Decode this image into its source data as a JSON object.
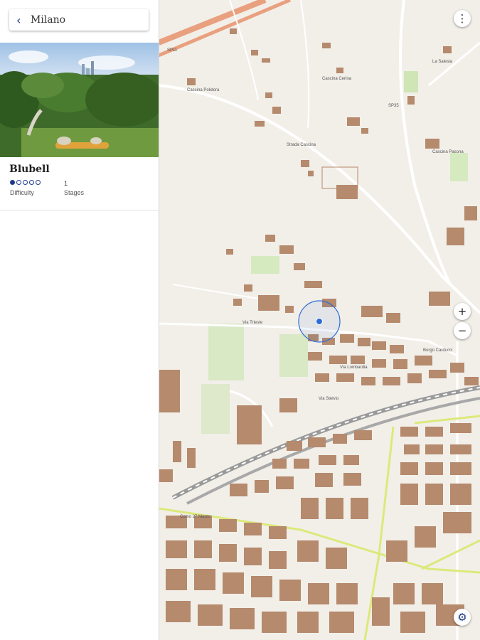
{
  "panel": {
    "back_label": "Milano",
    "back_icon": "chevron-left-icon",
    "trail_name": "Blubell",
    "difficulty_level": 1,
    "difficulty_max": 5,
    "difficulty_label": "Difficulty",
    "stages_value": "1",
    "stages_label": "Stages"
  },
  "map": {
    "controls": {
      "menu_icon": "more-vert-icon",
      "zoom_in": "+",
      "zoom_out": "−",
      "settings_icon": "gear-icon"
    },
    "labels": {
      "road_a": "SP11",
      "road_b": "SP35",
      "road_c": "Strada Cascina",
      "road_d": "Via Trieste",
      "road_e": "Via Lombardia",
      "road_f": "Corso 27 Marzo",
      "place_a": "Cascina Polidora",
      "place_b": "Cascina Cerina",
      "place_c": "La Salesia",
      "place_d": "Cascina Pasona",
      "place_e": "Borgo Carducci",
      "place_f": "Via Stelvio"
    },
    "colors": {
      "background": "#f2efe9",
      "building": "#b58a6d",
      "road_major": "#e9a07f",
      "road_secondary": "#dce97a",
      "railway": "#9a9a9a",
      "location": "#2c6bd8"
    }
  }
}
